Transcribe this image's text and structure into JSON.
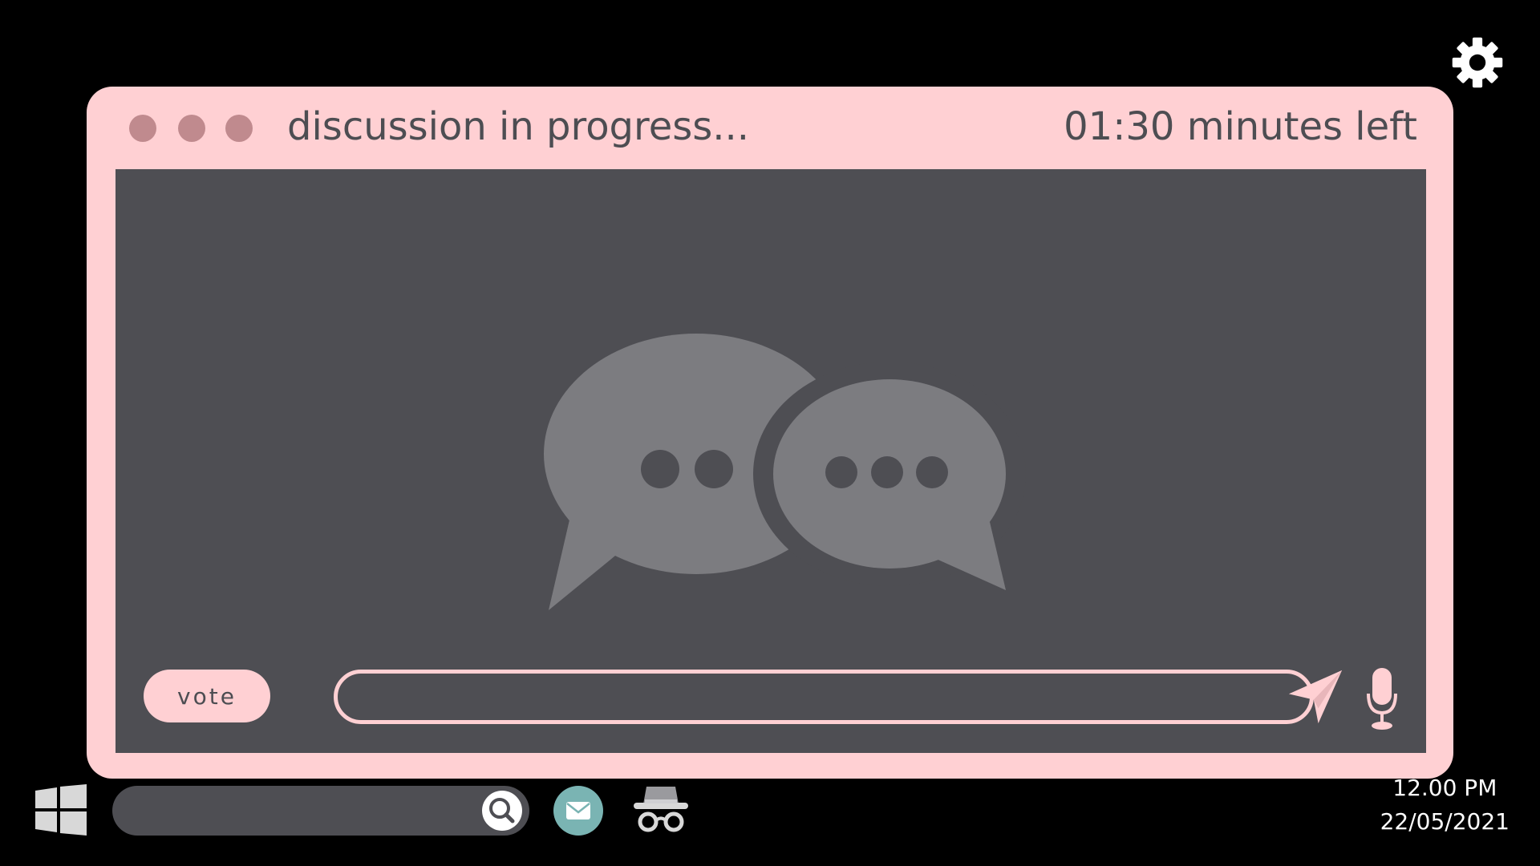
{
  "window": {
    "title": "discussion in progress...",
    "timer": "01:30 minutes left"
  },
  "composer": {
    "vote_label": "vote",
    "message_value": "",
    "message_placeholder": ""
  },
  "taskbar": {
    "search_value": "",
    "search_placeholder": "",
    "apps": [
      "start-menu",
      "mail",
      "incognito"
    ],
    "time": "12.00 PM",
    "date": "22/05/2021"
  },
  "icons": {
    "settings": "gear-icon",
    "window_controls": [
      "window-dot",
      "window-dot",
      "window-dot"
    ],
    "illustration": "chat-bubbles-icon",
    "send": "paper-plane-icon",
    "mic": "microphone-icon",
    "start": "windows-logo-icon",
    "search": "magnifier-icon",
    "mail": "envelope-icon",
    "incognito": "incognito-icon"
  },
  "colors": {
    "background": "#000000",
    "window": "#ffd0d3",
    "content": "#4e4e53",
    "text_dark": "#4d4d52",
    "dot": "#c08a8e",
    "illustration": "#7c7c80",
    "mail_bg": "#7ab4b3"
  }
}
